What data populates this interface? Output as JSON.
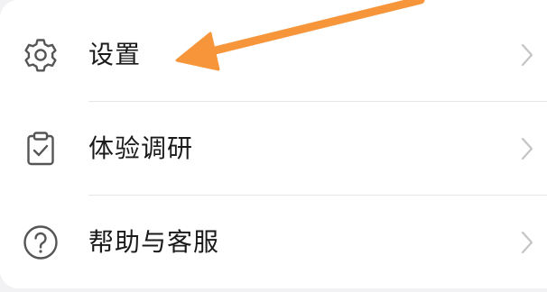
{
  "menu": {
    "items": [
      {
        "label": "设置",
        "icon": "gear-icon"
      },
      {
        "label": "体验调研",
        "icon": "clipboard-check-icon"
      },
      {
        "label": "帮助与客服",
        "icon": "help-circle-icon"
      }
    ]
  },
  "annotation": {
    "icon": "arrow-annotation",
    "color": "#f7953a"
  },
  "colors": {
    "text": "#1a1a1a",
    "icon": "#555555",
    "chevron": "#c4c4c6",
    "divider": "#e6e6e8",
    "background": "#f2f2f4"
  }
}
